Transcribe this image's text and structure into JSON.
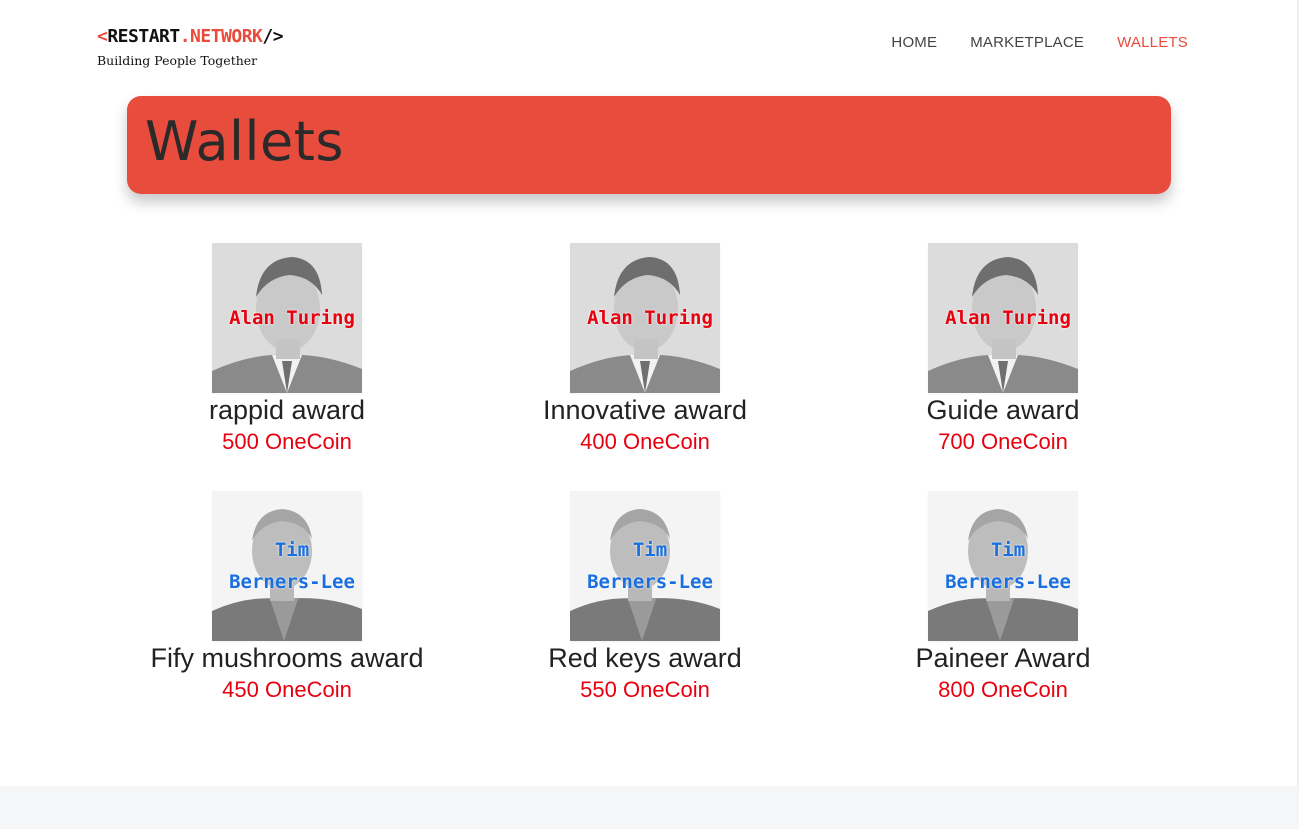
{
  "brand": {
    "prefix": "<",
    "name_a": "RESTART",
    "name_b": ".NETWORK",
    "suffix": "/>",
    "tagline": "Building People Together"
  },
  "nav": {
    "items": [
      {
        "label": "HOME",
        "active": false
      },
      {
        "label": "MARKETPLACE",
        "active": false
      },
      {
        "label": "WALLETS",
        "active": true
      }
    ]
  },
  "page_title": "Wallets",
  "colors": {
    "accent": "#e74c3c",
    "coin_text": "#e8000f",
    "turing_label": "#e8000f",
    "tbl_label": "#1a6fe0"
  },
  "wallets": [
    {
      "avatar_line1": "Alan Turing",
      "avatar_line2": "",
      "avatar_color": "red",
      "title": "rappid award",
      "amount": "500 OneCoin"
    },
    {
      "avatar_line1": "Alan Turing",
      "avatar_line2": "",
      "avatar_color": "red",
      "title": "Innovative award",
      "amount": "400 OneCoin"
    },
    {
      "avatar_line1": "Alan Turing",
      "avatar_line2": "",
      "avatar_color": "red",
      "title": "Guide award",
      "amount": "700 OneCoin"
    },
    {
      "avatar_line1": "Tim",
      "avatar_line2": "Berners-Lee",
      "avatar_color": "blue",
      "title": "Fify mushrooms award",
      "amount": "450 OneCoin"
    },
    {
      "avatar_line1": "Tim",
      "avatar_line2": "Berners-Lee",
      "avatar_color": "blue",
      "title": "Red keys award",
      "amount": "550 OneCoin"
    },
    {
      "avatar_line1": "Tim",
      "avatar_line2": "Berners-Lee",
      "avatar_color": "blue",
      "title": "Paineer Award",
      "amount": "800 OneCoin"
    }
  ]
}
